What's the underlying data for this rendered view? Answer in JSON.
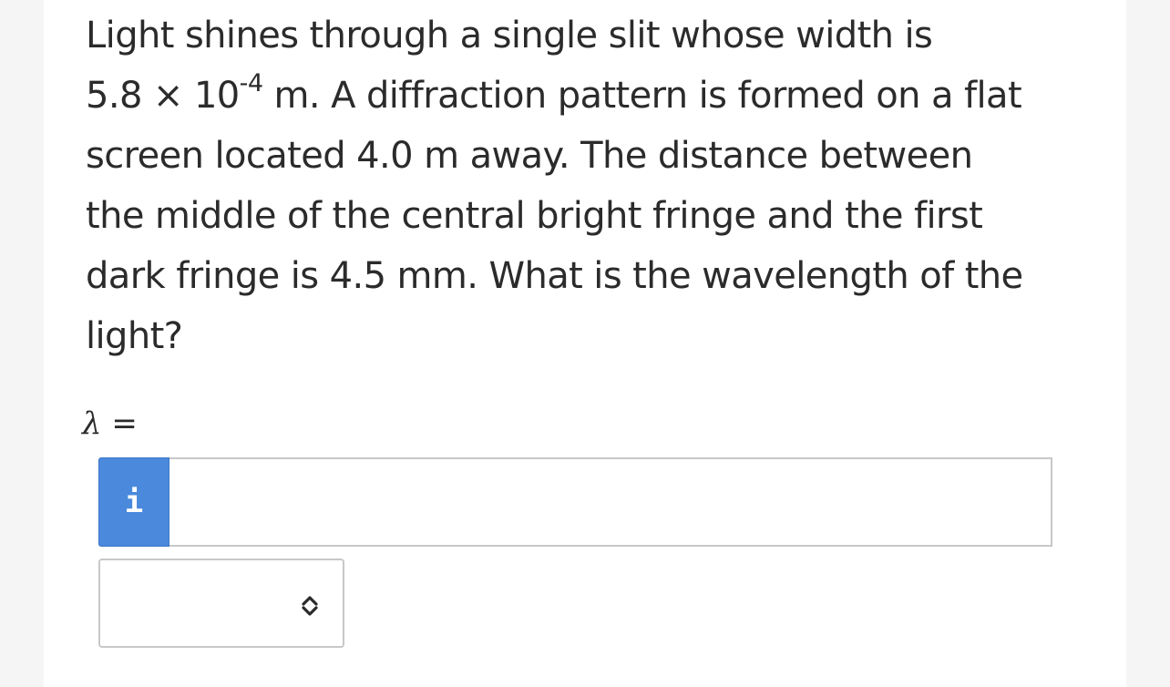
{
  "question": {
    "line1": "Light shines through a single slit whose width is",
    "line2_pre": "5.8 × 10",
    "line2_exp": "-4",
    "line2_post": " m. A diffraction pattern is formed on a flat",
    "line3": "screen located 4.0 m away. The distance between",
    "line4": "the middle of the central bright fringe and the first",
    "line5": "dark fringe is 4.5 mm. What is the wavelength of the",
    "line6": "light?"
  },
  "answer": {
    "symbol": "λ",
    "equals": " =",
    "info_label": "i",
    "value": "",
    "unit_selected": "",
    "unit_icon": "chevron-up-down-icon"
  },
  "colors": {
    "info_button": "#4a89dc",
    "text": "#2b2b2b",
    "border": "#c8c8c8"
  }
}
